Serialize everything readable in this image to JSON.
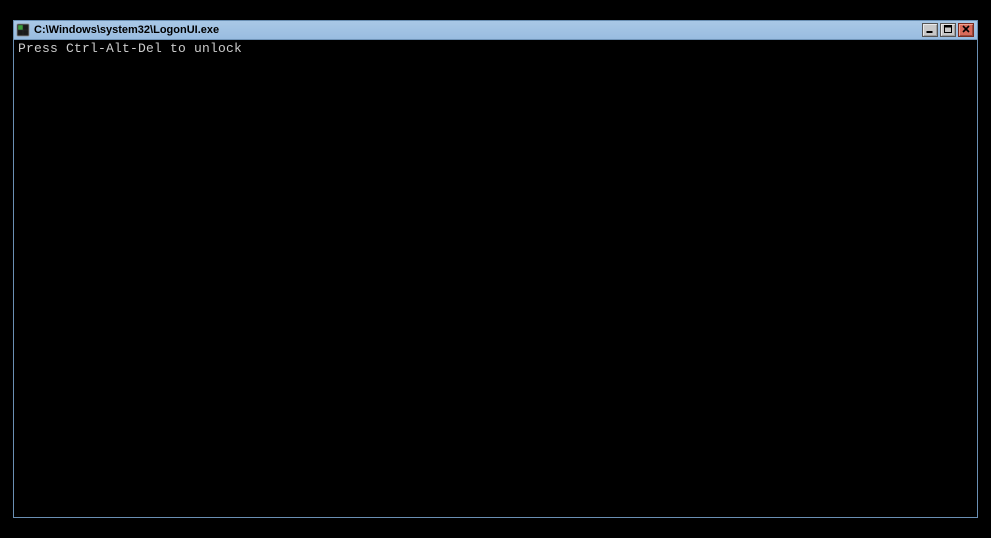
{
  "window": {
    "title": "C:\\Windows\\system32\\LogonUI.exe"
  },
  "console": {
    "line1": "Press Ctrl-Alt-Del to unlock"
  }
}
